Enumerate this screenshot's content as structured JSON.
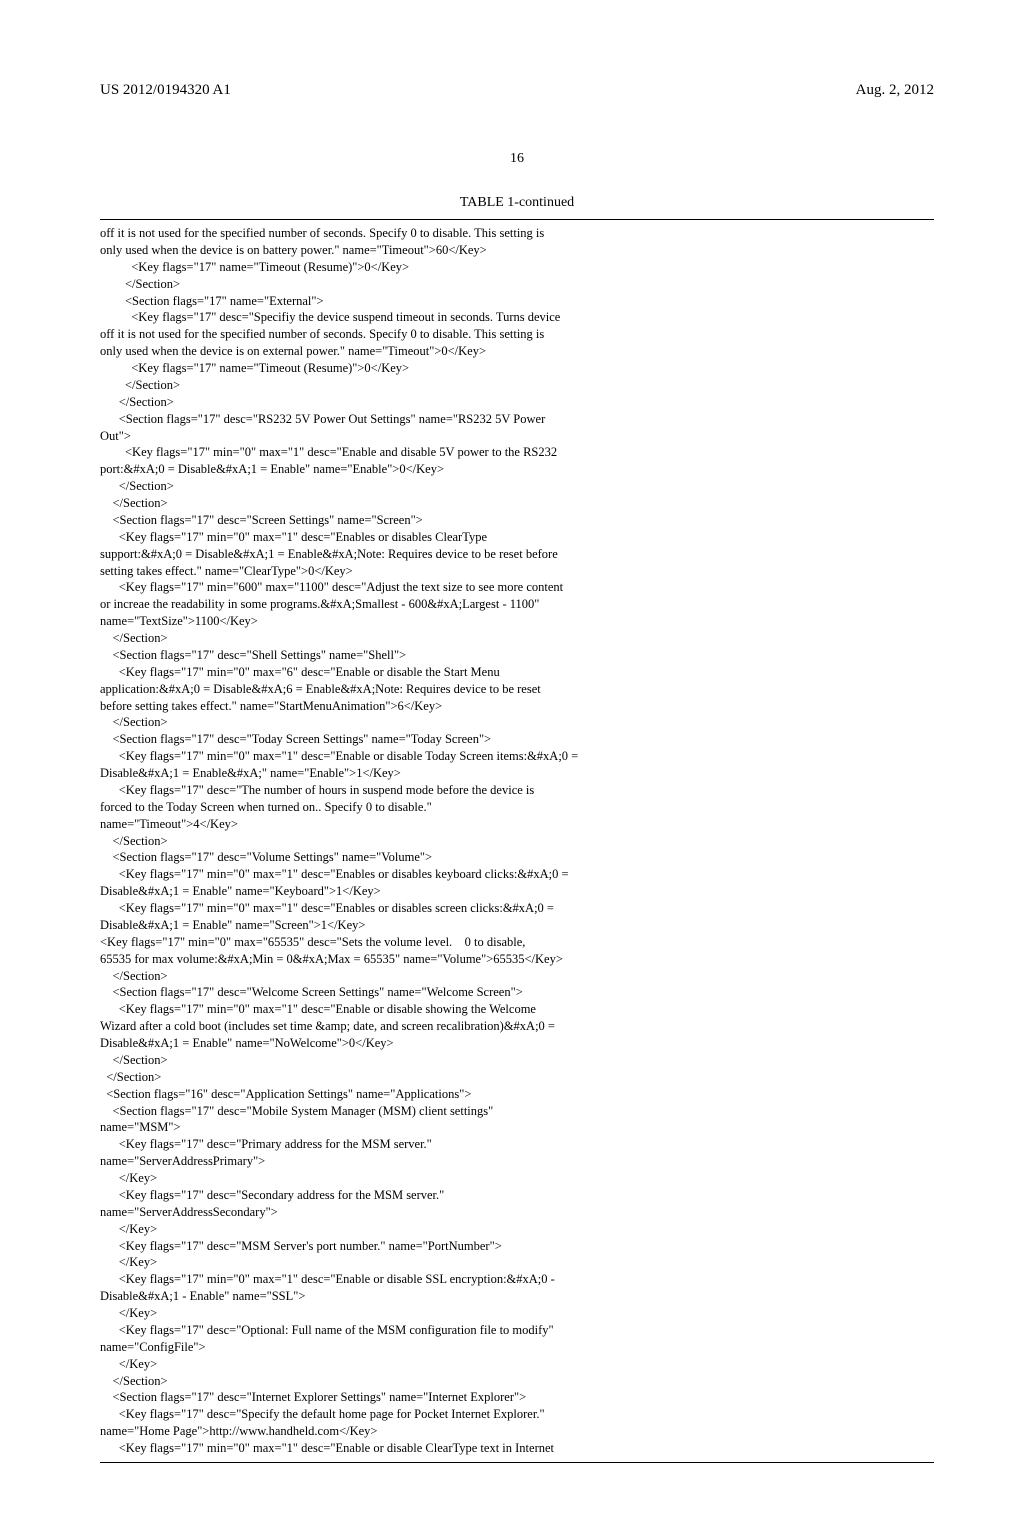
{
  "header": {
    "pub_number": "US 2012/0194320 A1",
    "pub_date": "Aug. 2, 2012"
  },
  "page_number": "16",
  "table_title": "TABLE 1-continued",
  "code_block": "off it is not used for the specified number of seconds. Specify 0 to disable. This setting is\nonly used when the device is on battery power.\" name=\"Timeout\">60</Key>\n          <Key flags=\"17\" name=\"Timeout (Resume)\">0</Key>\n        </Section>\n        <Section flags=\"17\" name=\"External\">\n          <Key flags=\"17\" desc=\"Specifiy the device suspend timeout in seconds. Turns device\noff it is not used for the specified number of seconds. Specify 0 to disable. This setting is\nonly used when the device is on external power.\" name=\"Timeout\">0</Key>\n          <Key flags=\"17\" name=\"Timeout (Resume)\">0</Key>\n        </Section>\n      </Section>\n      <Section flags=\"17\" desc=\"RS232 5V Power Out Settings\" name=\"RS232 5V Power\nOut\">\n        <Key flags=\"17\" min=\"0\" max=\"1\" desc=\"Enable and disable 5V power to the RS232\nport:&#xA;0 = Disable&#xA;1 = Enable\" name=\"Enable\">0</Key>\n      </Section>\n    </Section>\n    <Section flags=\"17\" desc=\"Screen Settings\" name=\"Screen\">\n      <Key flags=\"17\" min=\"0\" max=\"1\" desc=\"Enables or disables ClearType\nsupport:&#xA;0 = Disable&#xA;1 = Enable&#xA;Note: Requires device to be reset before\nsetting takes effect.\" name=\"ClearType\">0</Key>\n      <Key flags=\"17\" min=\"600\" max=\"1100\" desc=\"Adjust the text size to see more content\nor increae the readability in some programs.&#xA;Smallest - 600&#xA;Largest - 1100\"\nname=\"TextSize\">1100</Key>\n    </Section>\n    <Section flags=\"17\" desc=\"Shell Settings\" name=\"Shell\">\n      <Key flags=\"17\" min=\"0\" max=\"6\" desc=\"Enable or disable the Start Menu\napplication:&#xA;0 = Disable&#xA;6 = Enable&#xA;Note: Requires device to be reset\nbefore setting takes effect.\" name=\"StartMenuAnimation\">6</Key>\n    </Section>\n    <Section flags=\"17\" desc=\"Today Screen Settings\" name=\"Today Screen\">\n      <Key flags=\"17\" min=\"0\" max=\"1\" desc=\"Enable or disable Today Screen items:&#xA;0 =\nDisable&#xA;1 = Enable&#xA;\" name=\"Enable\">1</Key>\n      <Key flags=\"17\" desc=\"The number of hours in suspend mode before the device is\nforced to the Today Screen when turned on.. Specify 0 to disable.\"\nname=\"Timeout\">4</Key>\n    </Section>\n    <Section flags=\"17\" desc=\"Volume Settings\" name=\"Volume\">\n      <Key flags=\"17\" min=\"0\" max=\"1\" desc=\"Enables or disables keyboard clicks:&#xA;0 =\nDisable&#xA;1 = Enable\" name=\"Keyboard\">1</Key>\n      <Key flags=\"17\" min=\"0\" max=\"1\" desc=\"Enables or disables screen clicks:&#xA;0 =\nDisable&#xA;1 = Enable\" name=\"Screen\">1</Key>\n<Key flags=\"17\" min=\"0\" max=\"65535\" desc=\"Sets the volume level.    0 to disable,\n65535 for max volume:&#xA;Min = 0&#xA;Max = 65535\" name=\"Volume\">65535</Key>\n    </Section>\n    <Section flags=\"17\" desc=\"Welcome Screen Settings\" name=\"Welcome Screen\">\n      <Key flags=\"17\" min=\"0\" max=\"1\" desc=\"Enable or disable showing the Welcome\nWizard after a cold boot (includes set time &amp; date, and screen recalibration)&#xA;0 =\nDisable&#xA;1 = Enable\" name=\"NoWelcome\">0</Key>\n    </Section>\n  </Section>\n  <Section flags=\"16\" desc=\"Application Settings\" name=\"Applications\">\n    <Section flags=\"17\" desc=\"Mobile System Manager (MSM) client settings\"\nname=\"MSM\">\n      <Key flags=\"17\" desc=\"Primary address for the MSM server.\"\nname=\"ServerAddressPrimary\">\n      </Key>\n      <Key flags=\"17\" desc=\"Secondary address for the MSM server.\"\nname=\"ServerAddressSecondary\">\n      </Key>\n      <Key flags=\"17\" desc=\"MSM Server's port number.\" name=\"PortNumber\">\n      </Key>\n      <Key flags=\"17\" min=\"0\" max=\"1\" desc=\"Enable or disable SSL encryption:&#xA;0 -\nDisable&#xA;1 - Enable\" name=\"SSL\">\n      </Key>\n      <Key flags=\"17\" desc=\"Optional: Full name of the MSM configuration file to modify\"\nname=\"ConfigFile\">\n      </Key>\n    </Section>\n    <Section flags=\"17\" desc=\"Internet Explorer Settings\" name=\"Internet Explorer\">\n      <Key flags=\"17\" desc=\"Specify the default home page for Pocket Internet Explorer.\"\nname=\"Home Page\">http://www.handheld.com</Key>\n      <Key flags=\"17\" min=\"0\" max=\"1\" desc=\"Enable or disable ClearType text in Internet"
}
